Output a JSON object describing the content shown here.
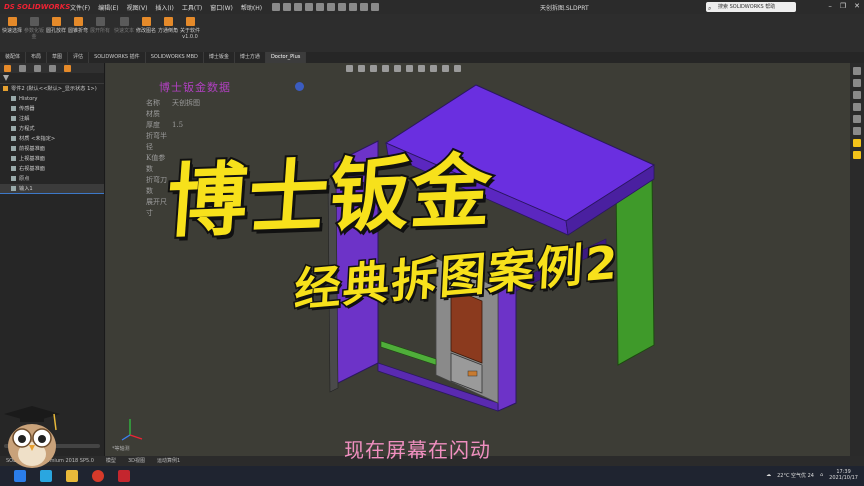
{
  "app": {
    "brand": "SOLIDWORKS",
    "document_title": "天创拆图.SLDPRT",
    "help_search_placeholder": "搜索 SOLIDWORKS 帮助"
  },
  "menu": [
    "文件(F)",
    "编辑(E)",
    "视图(V)",
    "插入(I)",
    "工具(T)",
    "窗口(W)",
    "帮助(H)"
  ],
  "command_buttons": [
    {
      "label": "快速选择",
      "enabled": true
    },
    {
      "label": "参数化钣金",
      "enabled": false
    },
    {
      "label": "圆孔放样",
      "enabled": true
    },
    {
      "label": "圆锥折弯",
      "enabled": true
    },
    {
      "label": "展开所有",
      "enabled": false
    },
    {
      "label": "快速文本",
      "enabled": false
    },
    {
      "label": "修改图名",
      "enabled": true
    },
    {
      "label": "方通倒角",
      "enabled": true
    },
    {
      "label": "关于软件v1.0.0",
      "enabled": true
    }
  ],
  "tabs": [
    {
      "label": "装配体",
      "active": false
    },
    {
      "label": "布局",
      "active": false
    },
    {
      "label": "草图",
      "active": false
    },
    {
      "label": "评估",
      "active": false
    },
    {
      "label": "SOLIDWORKS 插件",
      "active": false
    },
    {
      "label": "SOLIDWORKS MBD",
      "active": false
    },
    {
      "label": "博士钣金",
      "active": false
    },
    {
      "label": "博士方通",
      "active": false
    },
    {
      "label": "Doctor_Plus",
      "active": true
    }
  ],
  "tree": [
    {
      "label": "零件2 (默认<<默认>_显示状态 1>)",
      "type": "part",
      "indent": 0
    },
    {
      "label": "History",
      "type": "folder",
      "indent": 1
    },
    {
      "label": "传感器",
      "type": "folder",
      "indent": 1
    },
    {
      "label": "注解",
      "type": "folder",
      "indent": 1
    },
    {
      "label": "方程式",
      "type": "folder",
      "indent": 1
    },
    {
      "label": "材质 <未指定>",
      "type": "material",
      "indent": 1
    },
    {
      "label": "前视基准面",
      "type": "plane",
      "indent": 1
    },
    {
      "label": "上视基准面",
      "type": "plane",
      "indent": 1
    },
    {
      "label": "右视基准面",
      "type": "plane",
      "indent": 1
    },
    {
      "label": "原点",
      "type": "origin",
      "indent": 1
    },
    {
      "label": "输入1",
      "type": "import",
      "indent": 1,
      "selected": true
    }
  ],
  "sheet_metal_notes": {
    "title": "博士钣金数据",
    "rows": [
      {
        "key": "名称",
        "value": "天创拆图"
      },
      {
        "key": "材质",
        "value": ""
      },
      {
        "key": "厚度",
        "value": "1.5"
      },
      {
        "key": "折弯半径",
        "value": ""
      },
      {
        "key": "K值参数",
        "value": ""
      },
      {
        "key": "折弯刀数",
        "value": ""
      },
      {
        "key": "展开尺寸",
        "value": ""
      }
    ]
  },
  "overlay": {
    "big_title": "博士钣金",
    "sub_title": "经典拆图案例2",
    "caption": "现在屏幕在闪动"
  },
  "triad_label": "*等轴测",
  "statusbar": {
    "version": "SOLIDWORKS Premium 2018 SP5.0",
    "items": [
      "模型",
      "3D视图",
      "运动算例1"
    ]
  },
  "taskbar": {
    "weather": "22°C 空气优 24",
    "time": "17:39",
    "date": "2021/10/17"
  },
  "colors": {
    "accent_orange": "#e58a2a",
    "box_top": "#6a2fe0",
    "box_side": "#7a3bd8",
    "side_green": "#3f9a2a",
    "title_yellow": "#f7e11b",
    "caption_pink": "#f08fc0",
    "notes_title": "#b040c0"
  }
}
